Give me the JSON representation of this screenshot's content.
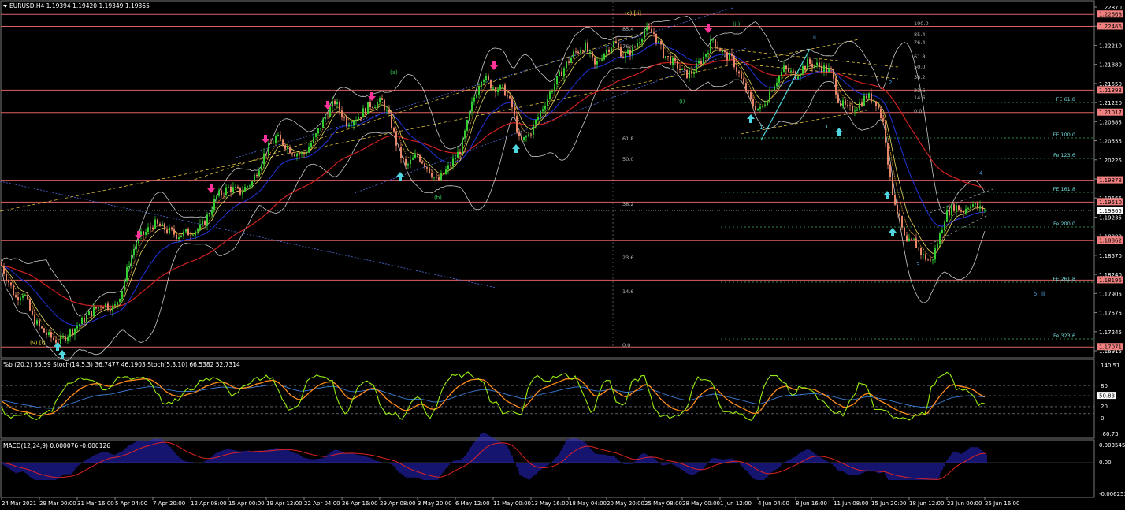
{
  "window": {
    "symbol_header": "EURUSD,H4  1.19394 1.19420 1.19349 1.19365"
  },
  "colors": {
    "background": "#000000",
    "bull_candle": "#33cc33",
    "bear_candle": "#e8866a",
    "ema_red": "#d02020",
    "ema_blue": "#2030d0",
    "bollinger": "#c8c8c8",
    "horizontal_level": "#e06060",
    "fib_green": "#2fae5a",
    "sell_arrow": "#ff3399",
    "buy_arrow": "#4fd6e0",
    "stoch_orange": "#ff8c1a",
    "stoch_green": "#99ee11",
    "macd_hist": "#2a2ae0",
    "macd_signal": "#dd2222"
  },
  "price_axis": {
    "labels": [
      "1.22870",
      "1.22540",
      "1.22210",
      "1.21880",
      "1.21550",
      "1.21220",
      "1.20885",
      "1.20555",
      "1.20225",
      "1.19895",
      "1.19565",
      "1.19235",
      "1.18900",
      "1.18570",
      "1.18240",
      "1.17905",
      "1.17575",
      "1.17245",
      "1.16915"
    ],
    "current_price": "1.19365",
    "tags": [
      {
        "label": "1.22668",
        "kind": "level"
      },
      {
        "label": "1.22466",
        "kind": "level"
      },
      {
        "label": "1.21393",
        "kind": "level"
      },
      {
        "label": "1.21017",
        "kind": "level"
      },
      {
        "label": "1.19878",
        "kind": "level"
      },
      {
        "label": "1.19510",
        "kind": "level"
      },
      {
        "label": "1.18862",
        "kind": "level"
      },
      {
        "label": "1.18196",
        "kind": "level"
      },
      {
        "label": "1.17071",
        "kind": "level"
      }
    ]
  },
  "time_axis": {
    "labels": [
      "24 Mar 2021",
      "29 Mar 00:00",
      "31 Mar 16:00",
      "5 Apr 04:00",
      "7 Apr 20:00",
      "12 Apr 08:00",
      "15 Apr 00:00",
      "19 Apr 12:00",
      "22 Apr 04:00",
      "26 Apr 16:00",
      "29 Apr 08:00",
      "3 May 20:00",
      "6 May 12:00",
      "11 May 00:00",
      "13 May 16:00",
      "18 May 04:00",
      "20 May 20:00",
      "25 May 08:00",
      "28 May 00:00",
      "1 Jun 12:00",
      "4 Jun 04:00",
      "8 Jun 16:00",
      "11 Jun 08:00",
      "15 Jun 20:00",
      "18 Jun 12:00",
      "23 Jun 00:00",
      "25 Jun 16:00"
    ]
  },
  "fib_retracement": {
    "labels": [
      "100.0",
      "85.4",
      "76.4",
      "61.8",
      "50.0",
      "38.2",
      "23.6",
      "14.6",
      "0.0"
    ]
  },
  "fib_small": {
    "labels": [
      "100.0",
      "85.4",
      "76.4",
      "61.8",
      "50.0",
      "38.2",
      "23.6",
      "14.6",
      "0.0"
    ]
  },
  "fe_labels": [
    "FE 61.8",
    "FE 100.0",
    "Fe 123.6",
    "FE 161.8",
    "Fe 200.0",
    "FE 261.8",
    "Fe 323.6"
  ],
  "wave_labels": {
    "c_ii": "(c) [ii]",
    "a": "(a)",
    "b": "(b)",
    "v_i": "(v) [i]",
    "ii_upper": "(ii)",
    "i_paren": "(i)",
    "ii_roman": "ii",
    "one_a": "1",
    "one_b": "1",
    "two": "2",
    "three": "3",
    "four": "4",
    "five": "5",
    "iii": "iii"
  },
  "stoch_panel": {
    "header": "%b (20,2) 55.59  Stoch(14,5,3) 36.7477 46.1903  Stoch(5,3,10) 66.5382 52.7314",
    "axis_labels": [
      "140.51",
      "80",
      "50.83",
      "0",
      "20",
      "-60.73"
    ]
  },
  "macd_panel": {
    "header": "MACD(12,24,9) 0.000076 -0.000126",
    "axis_labels": [
      "0.003545",
      "0.00",
      "-0.006253"
    ]
  },
  "chart_data": {
    "type": "candlestick",
    "title": "EURUSD,H4",
    "symbol": "EURUSD",
    "timeframe": "H4",
    "ohlc_header": {
      "open": 1.19394,
      "high": 1.1942,
      "low": 1.19349,
      "close": 1.19365
    },
    "ylim": [
      1.16915,
      1.2287
    ],
    "horizontal_levels": [
      1.22668,
      1.22466,
      1.21393,
      1.21017,
      1.19878,
      1.1951,
      1.18862,
      1.18196,
      1.17071
    ],
    "price_path": [
      [
        0,
        1.185
      ],
      [
        10,
        1.182
      ],
      [
        20,
        1.179
      ],
      [
        30,
        1.18
      ],
      [
        40,
        1.176
      ],
      [
        50,
        1.174
      ],
      [
        62,
        1.1725
      ],
      [
        75,
        1.1715
      ],
      [
        85,
        1.1728
      ],
      [
        100,
        1.1745
      ],
      [
        115,
        1.1765
      ],
      [
        130,
        1.178
      ],
      [
        145,
        1.1772
      ],
      [
        155,
        1.1805
      ],
      [
        165,
        1.1855
      ],
      [
        175,
        1.189
      ],
      [
        185,
        1.19
      ],
      [
        195,
        1.1915
      ],
      [
        210,
        1.1905
      ],
      [
        225,
        1.1895
      ],
      [
        240,
        1.19
      ],
      [
        255,
        1.1908
      ],
      [
        265,
        1.193
      ],
      [
        275,
        1.196
      ],
      [
        290,
        1.1975
      ],
      [
        305,
        1.1968
      ],
      [
        320,
        1.1985
      ],
      [
        335,
        1.203
      ],
      [
        350,
        1.206
      ],
      [
        360,
        1.205
      ],
      [
        372,
        1.2035
      ],
      [
        385,
        1.203
      ],
      [
        400,
        1.206
      ],
      [
        415,
        1.21
      ],
      [
        425,
        1.212
      ],
      [
        440,
        1.2085
      ],
      [
        455,
        1.2095
      ],
      [
        470,
        1.2115
      ],
      [
        485,
        1.212
      ],
      [
        495,
        1.209
      ],
      [
        505,
        1.204
      ],
      [
        515,
        1.201
      ],
      [
        530,
        1.203
      ],
      [
        545,
        1.2005
      ],
      [
        555,
        1.1985
      ],
      [
        570,
        1.201
      ],
      [
        585,
        1.204
      ],
      [
        600,
        1.212
      ],
      [
        612,
        1.2165
      ],
      [
        625,
        1.2145
      ],
      [
        640,
        1.214
      ],
      [
        650,
        1.211
      ],
      [
        660,
        1.205
      ],
      [
        672,
        1.2065
      ],
      [
        685,
        1.21
      ],
      [
        700,
        1.214
      ],
      [
        715,
        1.2175
      ],
      [
        728,
        1.22
      ],
      [
        742,
        1.2215
      ],
      [
        755,
        1.218
      ],
      [
        768,
        1.2205
      ],
      [
        780,
        1.222
      ],
      [
        792,
        1.2195
      ],
      [
        805,
        1.221
      ],
      [
        818,
        1.224
      ],
      [
        830,
        1.2235
      ],
      [
        842,
        1.22
      ],
      [
        855,
        1.2185
      ],
      [
        870,
        1.2165
      ],
      [
        880,
        1.217
      ],
      [
        893,
        1.2195
      ],
      [
        905,
        1.2225
      ],
      [
        918,
        1.22
      ],
      [
        930,
        1.219
      ],
      [
        943,
        1.215
      ],
      [
        955,
        1.2115
      ],
      [
        966,
        1.2105
      ],
      [
        980,
        1.2145
      ],
      [
        995,
        1.2175
      ],
      [
        1010,
        1.2165
      ],
      [
        1025,
        1.2185
      ],
      [
        1040,
        1.218
      ],
      [
        1055,
        1.217
      ],
      [
        1065,
        1.212
      ],
      [
        1078,
        1.2105
      ],
      [
        1090,
        1.2115
      ],
      [
        1100,
        1.213
      ],
      [
        1112,
        1.212
      ],
      [
        1122,
        1.208
      ],
      [
        1130,
        1.1985
      ],
      [
        1140,
        1.193
      ],
      [
        1150,
        1.188
      ],
      [
        1160,
        1.1885
      ],
      [
        1172,
        1.186
      ],
      [
        1182,
        1.185
      ],
      [
        1192,
        1.189
      ],
      [
        1200,
        1.193
      ],
      [
        1212,
        1.1945
      ],
      [
        1222,
        1.1935
      ],
      [
        1232,
        1.195
      ],
      [
        1242,
        1.194
      ],
      [
        1252,
        1.1937
      ]
    ]
  }
}
